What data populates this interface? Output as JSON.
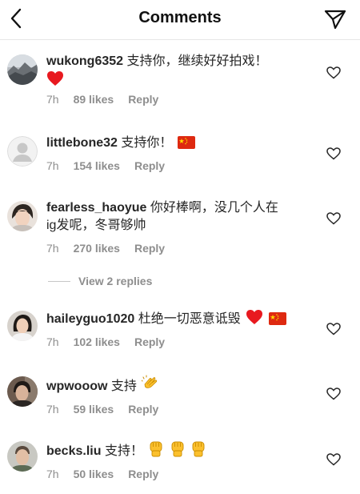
{
  "header": {
    "title": "Comments"
  },
  "colors": {
    "text": "#262626",
    "muted": "#8e8e8e",
    "heart_red": "#e8191f",
    "flag_red": "#de2910",
    "flag_star": "#ffde00",
    "emoji_yellow": "#fbc02d"
  },
  "comments": [
    {
      "username": "wukong6352",
      "text": "支持你，继续好好拍戏！",
      "emoji": [
        "red-heart"
      ],
      "time": "7h",
      "likes": "89 likes",
      "reply": "Reply"
    },
    {
      "username": "littlebone32",
      "text": "支持你！",
      "emoji": [
        "china-flag"
      ],
      "time": "7h",
      "likes": "154 likes",
      "reply": "Reply"
    },
    {
      "username": "fearless_haoyue",
      "text": "你好棒啊，没几个人在",
      "text2": "ig发呢，冬哥够帅",
      "time": "7h",
      "likes": "270 likes",
      "reply": "Reply",
      "view_replies": "View 2 replies"
    },
    {
      "username": "haileyguo1020",
      "text": "杜绝一切恶意诋毁",
      "emoji": [
        "red-heart",
        "china-flag"
      ],
      "time": "7h",
      "likes": "102 likes",
      "reply": "Reply"
    },
    {
      "username": "wpwooow",
      "text": "支持",
      "emoji": [
        "clapping-hands"
      ],
      "time": "7h",
      "likes": "59 likes",
      "reply": "Reply"
    },
    {
      "username": "becks.liu",
      "text": "支持！",
      "emoji": [
        "raised-fist",
        "raised-fist",
        "raised-fist"
      ],
      "time": "7h",
      "likes": "50 likes",
      "reply": "Reply"
    }
  ]
}
